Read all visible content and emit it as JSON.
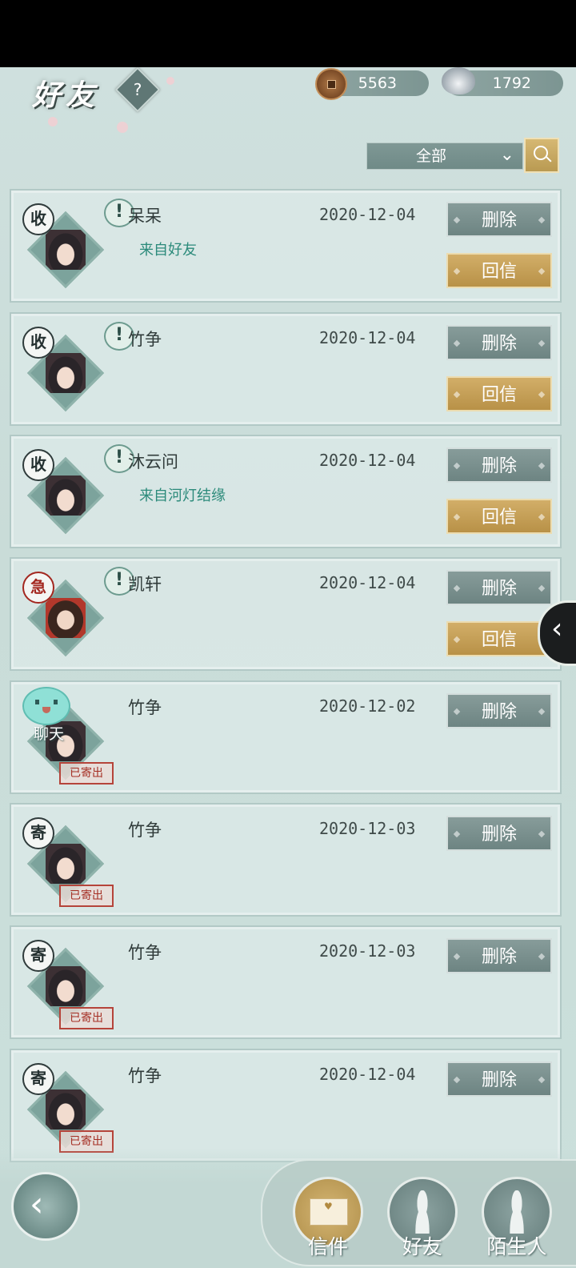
{
  "header": {
    "title": "好友",
    "help_label": "?",
    "copper": "5563",
    "silver": "1792"
  },
  "filter": {
    "selected": "全部"
  },
  "mails": [
    {
      "seal": "收",
      "seal_type": "received",
      "unread": true,
      "name": "呆呆",
      "date": "2020-12-04",
      "from": "来自好友",
      "sent": false,
      "delete_label": "删除",
      "reply_label": "回信"
    },
    {
      "seal": "收",
      "seal_type": "received",
      "unread": true,
      "name": "竹争",
      "date": "2020-12-04",
      "from": "",
      "sent": false,
      "delete_label": "删除",
      "reply_label": "回信"
    },
    {
      "seal": "收",
      "seal_type": "received",
      "unread": true,
      "name": "沐云问",
      "date": "2020-12-04",
      "from": "来自河灯结缘",
      "sent": false,
      "delete_label": "删除",
      "reply_label": "回信"
    },
    {
      "seal": "急",
      "seal_type": "urgent",
      "unread": true,
      "name": "凯轩",
      "date": "2020-12-04",
      "from": "",
      "sent": false,
      "delete_label": "删除",
      "reply_label": "回信"
    },
    {
      "seal": "",
      "seal_type": "chat",
      "chat_label": "聊天",
      "unread": false,
      "name": "竹争",
      "date": "2020-12-02",
      "from": "",
      "sent": true,
      "stamp": "已寄出",
      "delete_label": "删除"
    },
    {
      "seal": "寄",
      "seal_type": "sent",
      "unread": false,
      "name": "竹争",
      "date": "2020-12-03",
      "from": "",
      "sent": true,
      "stamp": "已寄出",
      "delete_label": "删除"
    },
    {
      "seal": "寄",
      "seal_type": "sent",
      "unread": false,
      "name": "竹争",
      "date": "2020-12-03",
      "from": "",
      "sent": true,
      "stamp": "已寄出",
      "delete_label": "删除"
    },
    {
      "seal": "寄",
      "seal_type": "sent",
      "unread": false,
      "name": "竹争",
      "date": "2020-12-04",
      "from": "",
      "sent": true,
      "stamp": "已寄出",
      "delete_label": "删除"
    }
  ],
  "bottom_tabs": [
    {
      "label": "信件",
      "icon": "envelope-icon",
      "active": true
    },
    {
      "label": "好友",
      "icon": "friend-icon",
      "active": false
    },
    {
      "label": "陌生人",
      "icon": "stranger-icon",
      "active": false
    }
  ],
  "colors": {
    "accent_gold": "#c9a45c",
    "button_gray": "#7b918f",
    "from_text": "#2b8a7a",
    "urgent_red": "#a3271f"
  }
}
